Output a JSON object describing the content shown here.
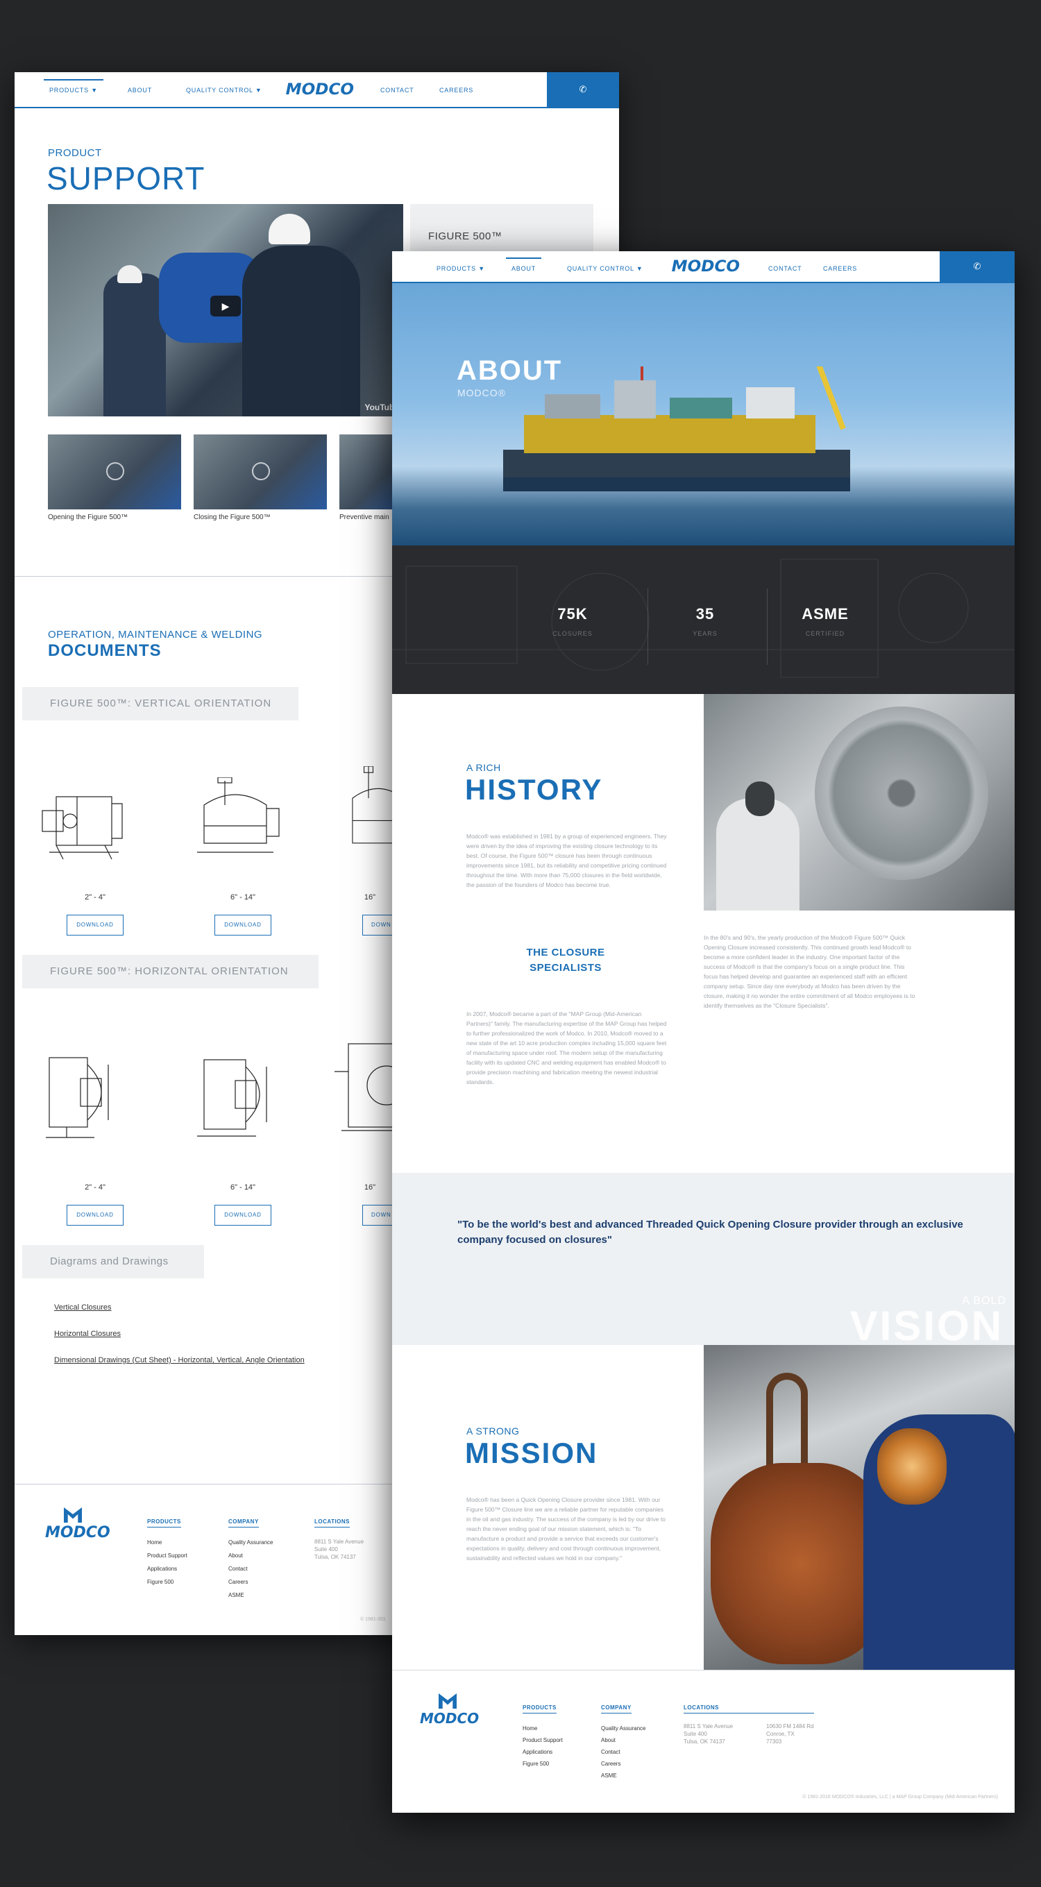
{
  "colors": {
    "brand": "#1a6eb5",
    "dark": "#2a2b2e",
    "light_panel": "#eef0f2"
  },
  "nav": {
    "products": "PRODUCTS ▼",
    "about": "ABOUT",
    "quality": "QUALITY CONTROL ▼",
    "logo": "MODCO",
    "contact": "CONTACT",
    "careers": "CAREERS",
    "phone_icon": "phone-icon"
  },
  "support": {
    "kicker": "PRODUCT",
    "title": "SUPPORT",
    "video_brand": "YouTube",
    "figure_panel": "FIGURE 500™",
    "thumbs": [
      "Opening the Figure 500™",
      "Closing the Figure 500™",
      "Preventive main"
    ]
  },
  "documents": {
    "kicker": "OPERATION, MAINTENANCE & WELDING",
    "title": "DOCUMENTS",
    "vertical_tab": "FIGURE 500™: VERTICAL ORIENTATION",
    "horizontal_tab": "FIGURE 500™: HORIZONTAL ORIENTATION",
    "sizes": [
      "2\" - 4\"",
      "6\" - 14\"",
      "16\""
    ],
    "download": "DOWNLOAD",
    "download_cut": "DOWN",
    "diagrams_tab": "Diagrams and Drawings",
    "links": [
      "Vertical Closures",
      "Horizontal Closures",
      "Dimensional Drawings (Cut Sheet) - Horizontal, Vertical, Angle Orientation"
    ]
  },
  "footer": {
    "logo": "MODCO",
    "products_h": "PRODUCTS",
    "products": [
      "Home",
      "Product Support",
      "Applications",
      "Figure 500"
    ],
    "company_h": "COMPANY",
    "company": [
      "Quality Assurance",
      "About",
      "Contact",
      "Careers",
      "ASME"
    ],
    "locations_h": "LOCATIONS",
    "addr1": [
      "8811 S Yale Avenue",
      "Suite 400",
      "Tulsa, OK 74137"
    ],
    "addr2": [
      "10630 FM 1484 Rd",
      "Conroe, TX",
      "77303"
    ],
    "copyright_cut": "© 1981-201",
    "copyright": "© 1981-2016 MODCO® Industries, LLC | a MAP Group Company (Mid-American Partners)"
  },
  "about": {
    "title": "ABOUT",
    "subtitle": "MODCO®",
    "stats": [
      {
        "value": "75K",
        "label": "CLOSURES"
      },
      {
        "value": "35",
        "label": "YEARS"
      },
      {
        "value": "ASME",
        "label": "CERTIFIED"
      }
    ],
    "history_kicker": "A RICH",
    "history_title": "HISTORY",
    "history_p1": "Modco® was established in 1981 by a group of experienced engineers. They were driven by the idea of improving the existing closure technology to its best. Of course, the Figure 500™ closure has been through continuous improvements since 1981, but its reliability and competitive pricing continued throughout the time. With more than 75,000 closures in the field worldwide, the passion of the founders of Modco has become true.",
    "history_p2": "In the 80's and 90's, the yearly production of the Modco® Figure 500™ Quick Opening Closure increased consistently. This continued growth lead Modco® to become a more confident leader in the industry. One important factor of the success of Modco® is that the company's focus on a single product line. This focus has helped develop and guarantee an experienced staff with an efficient company setup. Since day one everybody at Modco has been driven by the closure, making it no wonder the entire commitment of all Modco employees is to identify themselves as the \"Closure Specialists\".",
    "specialists_title": "THE CLOSURE SPECIALISTS",
    "specialists_p": "In 2007, Modco® became a part of the \"MAP Group (Mid-American Partners)\" family. The manufacturing expertise of the MAP Group has helped to further professionalized the work of Modco. In 2010, Modco® moved to a new state of the art 10 acre production complex including 15,000 square feet of manufacturing space under roof. The modern setup of the manufacturing facility with its updated CNC and welding equipment has enabled Modco® to provide precision machining and fabrication meeting the newest industrial standards.",
    "vision_quote": "\"To be the world's best and advanced Threaded Quick Opening Closure provider through an exclusive company focused on closures\"",
    "vision_kicker": "A BOLD",
    "vision_word": "VISION",
    "mission_kicker": "A STRONG",
    "mission_title": "MISSION",
    "mission_p": "Modco® has been a Quick Opening Closure provider since 1981. With our Figure 500™ Closure line we are a reliable partner for reputable companies in the oil and gas industry. The success of the company is led by our drive to reach the never ending goal of our mission statement, which is: \"To manufacture a product and provide a service that exceeds our customer's expectations in quality, delivery and cost through continuous improvement, sustainability and reflected values we hold in our company.\""
  }
}
